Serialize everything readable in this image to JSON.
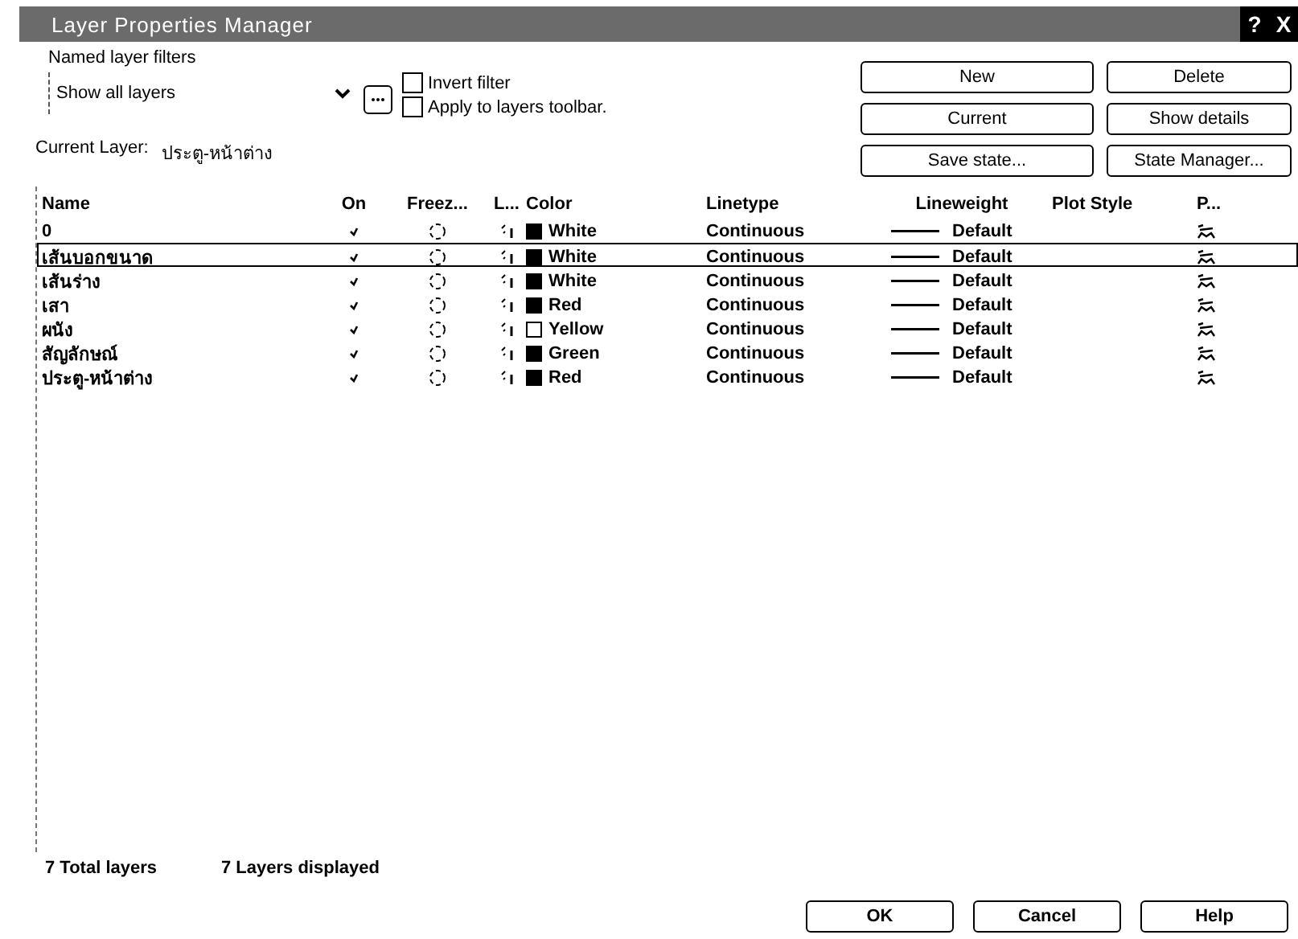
{
  "window": {
    "title": "Layer Properties Manager"
  },
  "filter": {
    "label": "Named layer filters",
    "value": "Show all layers",
    "invert_filter": {
      "label": "Invert filter",
      "checked": false
    },
    "apply_toolbar": {
      "label": "Apply to layers toolbar.",
      "checked": false
    }
  },
  "buttons_top": [
    "New",
    "Delete",
    "Current",
    "Show details",
    "Save state...",
    "State Manager..."
  ],
  "current_layer": {
    "label": "Current Layer:",
    "value": "ประตู-หน้าต่าง"
  },
  "table": {
    "columns": [
      "Name",
      "On",
      "Freez...",
      "L...",
      "Color",
      "Linetype",
      "Lineweight",
      "Plot Style",
      "P..."
    ],
    "rows": [
      {
        "name": "0",
        "selected": false,
        "color_name": "White",
        "swatch_filled": true,
        "linetype": "Continuous",
        "lineweight": "Default"
      },
      {
        "name": "เส้นบอกขนาด",
        "selected": true,
        "color_name": "White",
        "swatch_filled": true,
        "linetype": "Continuous",
        "lineweight": "Default"
      },
      {
        "name": "เส้นร่าง",
        "selected": false,
        "color_name": "White",
        "swatch_filled": true,
        "linetype": "Continuous",
        "lineweight": "Default"
      },
      {
        "name": "เสา",
        "selected": false,
        "color_name": "Red",
        "swatch_filled": true,
        "linetype": "Continuous",
        "lineweight": "Default"
      },
      {
        "name": "ผนัง",
        "selected": false,
        "color_name": "Yellow",
        "swatch_filled": false,
        "linetype": "Continuous",
        "lineweight": "Default"
      },
      {
        "name": "สัญลักษณ์",
        "selected": false,
        "color_name": "Green",
        "swatch_filled": true,
        "linetype": "Continuous",
        "lineweight": "Default"
      },
      {
        "name": "ประตู-หน้าต่าง",
        "selected": false,
        "color_name": "Red",
        "swatch_filled": true,
        "linetype": "Continuous",
        "lineweight": "Default"
      }
    ]
  },
  "status": {
    "total": "7 Total layers",
    "displayed": "7 Layers displayed"
  },
  "buttons_bottom": [
    "OK",
    "Cancel",
    "Help"
  ],
  "title_buttons": [
    "?",
    "X"
  ]
}
